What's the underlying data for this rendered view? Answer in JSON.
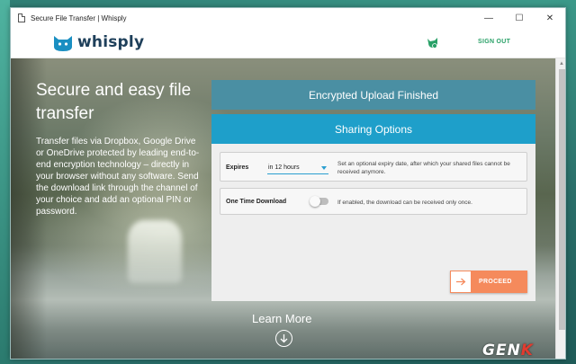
{
  "window": {
    "title": "Secure File Transfer | Whisply",
    "controls": [
      "—",
      "☐",
      "✕"
    ]
  },
  "header": {
    "logo_text": "whisply",
    "sign_out": "SIGN OUT",
    "brand_color": "#1e3f5a",
    "accent_green": "#2aa168"
  },
  "hero": {
    "title": "Secure and easy file transfer",
    "description": "Transfer files via Dropbox, Google Drive or OneDrive protected by leading end-to-end encryption technology – directly in your browser without any software. Send the download link through the channel of your choice and add an optional PIN or password.",
    "learn_more": "Learn More"
  },
  "upload_banner": {
    "label": "Encrypted Upload Finished",
    "color": "#4a8fa3"
  },
  "sharing": {
    "header": "Sharing Options",
    "header_color": "#1e9fca",
    "expires": {
      "label": "Expires",
      "value": "in 12 hours",
      "help": "Set an optional expiry date, after which your shared files cannot be received anymore."
    },
    "one_time": {
      "label": "One Time Download",
      "enabled": false,
      "help": "If enabled, the download can be received only once."
    },
    "proceed_label": "PROCEED",
    "proceed_color": "#f58a5c"
  },
  "watermark": {
    "text_main": "GEN",
    "text_accent": "K"
  }
}
